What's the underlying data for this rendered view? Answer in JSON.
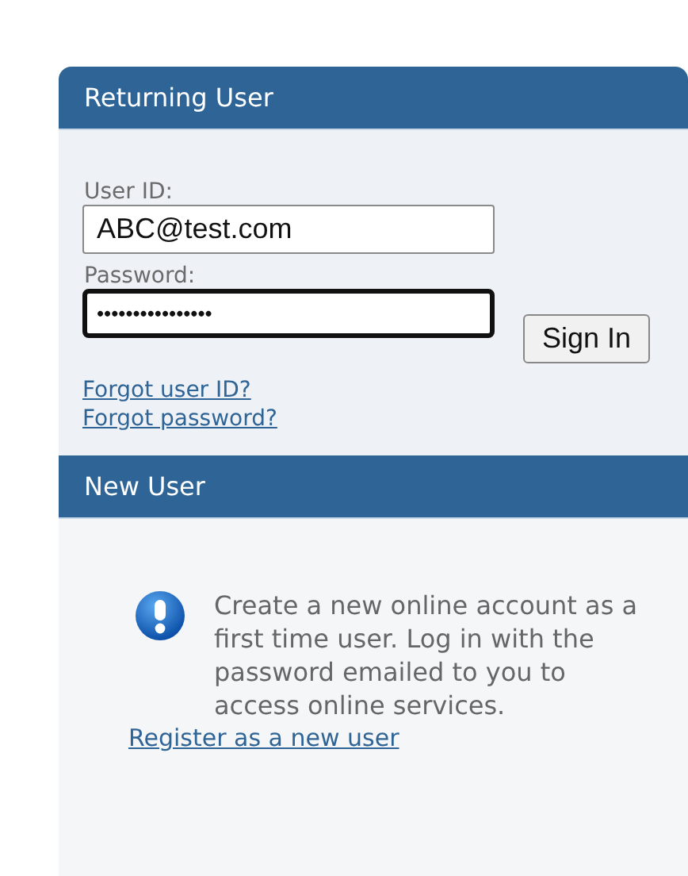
{
  "returning_user": {
    "title": "Returning User",
    "fields": [
      {
        "label": "User ID:",
        "value": "ABC@test.com",
        "focused": false
      },
      {
        "label": "Password:",
        "value": "••••••••••••••••",
        "focused": true
      }
    ],
    "button": "Sign In",
    "links": [
      "Forgot user ID?",
      "Forgot password?"
    ]
  },
  "new_user": {
    "title": "New User",
    "message": "Create a new online account as a first time user. Log in with the password emailed to you to access online services.",
    "link": "Register as a new user"
  }
}
